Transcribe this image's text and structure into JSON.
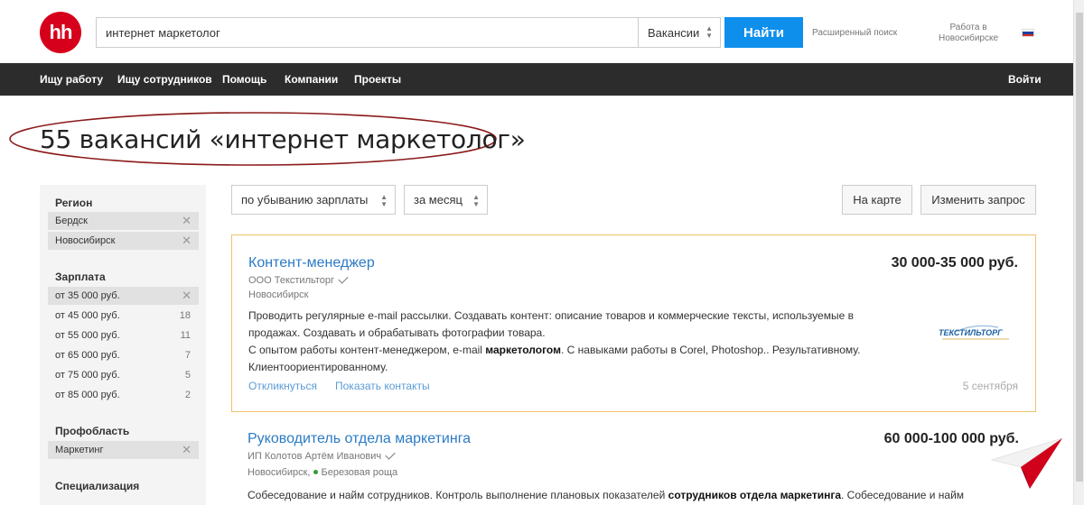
{
  "header": {
    "logo": "hh",
    "search_value": "интернет маркетолог",
    "search_type": "Вакансии",
    "search_button": "Найти",
    "advanced_search": "Расширенный поиск",
    "work_in_line1": "Работа в",
    "work_in_line2": "Новосибирске",
    "flag_colors": [
      "#ffffff",
      "#1c3fa0",
      "#d52b1e"
    ]
  },
  "nav": {
    "items": [
      "Ищу работу",
      "Ищу сотрудников",
      "Помощь",
      "Компании",
      "Проекты"
    ],
    "login": "Войти"
  },
  "page_title": "55 вакансий «интернет маркетолог»",
  "sidebar": {
    "region": {
      "title": "Регион",
      "chips": [
        "Бердск",
        "Новосибирск"
      ]
    },
    "salary": {
      "title": "Зарплата",
      "selected": "от 35 000 руб.",
      "options": [
        {
          "label": "от 45 000 руб.",
          "count": "18"
        },
        {
          "label": "от 55 000 руб.",
          "count": "11"
        },
        {
          "label": "от 65 000 руб.",
          "count": "7"
        },
        {
          "label": "от 75 000 руб.",
          "count": "5"
        },
        {
          "label": "от 85 000 руб.",
          "count": "2"
        }
      ]
    },
    "profarea": {
      "title": "Профобласть",
      "chips": [
        "Маркетинг"
      ]
    },
    "specialization": {
      "title": "Специализация"
    }
  },
  "controls": {
    "sort": "по убыванию зарплаты",
    "period": "за месяц",
    "map_button": "На карте",
    "edit_button": "Изменить запрос"
  },
  "vacancies": [
    {
      "title": "Контент-менеджер",
      "salary": "30 000-35 000 руб.",
      "company": "ООО Текстильторг",
      "city": "Новосибирск",
      "text_1": "Проводить регулярные e-mail рассылки. Создавать контент: описание товаров и коммерческие тексты, используемые в продажах. Создавать и обрабатывать фотографии товара.",
      "text_2a": "С опытом работы контент-менеджером, e-mail ",
      "text_2b": "маркетологом",
      "text_2c": ". С навыками работы в Corel, Photoshop.. Результативному. Клиентоориентированному.",
      "respond": "Откликнуться",
      "show_contacts": "Показать контакты",
      "date": "5 сентября",
      "logo_text": "ТЕКСТИЛЬТОРГ"
    },
    {
      "title": "Руководитель отдела маркетинга",
      "salary": "60 000-100 000 руб.",
      "company": "ИП Колотов Артём Иванович",
      "city": "Новосибирск,",
      "metro": "Березовая роща",
      "text_1a": "Собеседование и найм сотрудников. Контроль выполнение плановых показателей ",
      "text_1b": "сотрудников отдела маркетинга",
      "text_1c": ". Собеседование и найм"
    }
  ],
  "colors": {
    "accent": "#0f8fec",
    "logo_red": "#d6001c",
    "nav_bg": "#2c2c2c",
    "link": "#2b7bc4",
    "ellipse": "#8b1a1a"
  }
}
